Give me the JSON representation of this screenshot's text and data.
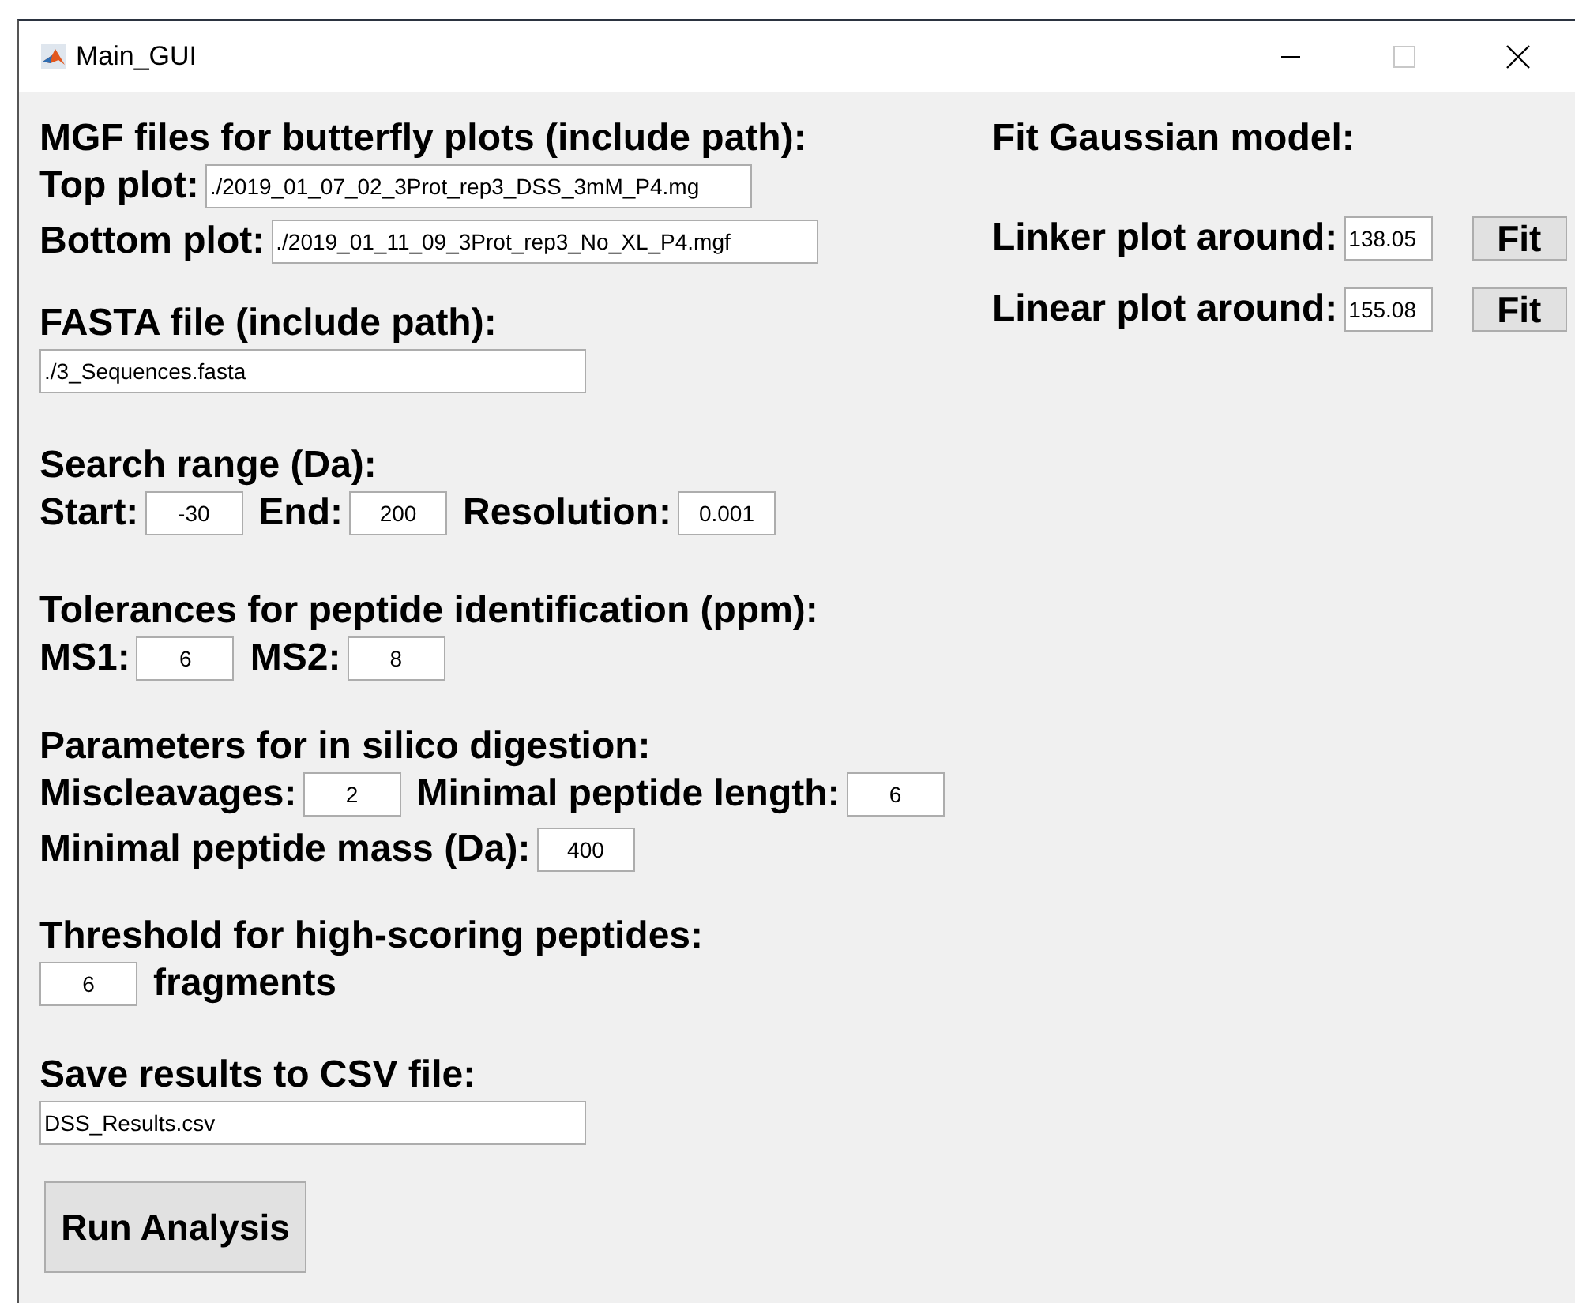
{
  "window": {
    "title": "Main_GUI",
    "maximize_enabled": false
  },
  "left_groups": [
    {
      "heading": "MGF files for butterfly plots (include path):",
      "lines": [
        {
          "items": [
            {
              "kind": "label",
              "text": "Top plot:"
            },
            {
              "kind": "path_field",
              "value": "./2019_01_07_02_3Prot_rep3_DSS_3mM_P4.mg"
            }
          ]
        },
        {
          "items": [
            {
              "kind": "label",
              "text": "Bottom plot:"
            },
            {
              "kind": "path_field",
              "value": "./2019_01_11_09_3Prot_rep3_No_XL_P4.mgf"
            }
          ]
        }
      ]
    },
    {
      "heading": "FASTA file (include path):",
      "lines": [
        {
          "items": [
            {
              "kind": "path_field",
              "value": "./3_Sequences.fasta"
            }
          ]
        }
      ]
    },
    {
      "heading": "Search range (Da):",
      "lines": [
        {
          "items": [
            {
              "kind": "label",
              "text": "Start:"
            },
            {
              "kind": "number_field",
              "value": "-30"
            },
            {
              "kind": "label",
              "text": "End:"
            },
            {
              "kind": "number_field",
              "value": "200"
            },
            {
              "kind": "label",
              "text": "Resolution:"
            },
            {
              "kind": "number_field",
              "value": "0.001"
            }
          ]
        }
      ]
    },
    {
      "heading": "Tolerances for peptide identification (ppm):",
      "lines": [
        {
          "items": [
            {
              "kind": "label",
              "text": "MS1:"
            },
            {
              "kind": "number_field",
              "value": "6"
            },
            {
              "kind": "label",
              "text": "MS2:"
            },
            {
              "kind": "number_field",
              "value": "8"
            }
          ]
        }
      ]
    },
    {
      "heading": "Parameters for in silico digestion:",
      "lines": [
        {
          "items": [
            {
              "kind": "label",
              "text": "Miscleavages:"
            },
            {
              "kind": "number_field",
              "value": "2"
            },
            {
              "kind": "label",
              "text": "Minimal peptide length:"
            },
            {
              "kind": "number_field",
              "value": "6"
            }
          ]
        },
        {
          "items": [
            {
              "kind": "label",
              "text": "Minimal peptide mass (Da):"
            },
            {
              "kind": "number_field",
              "value": "400"
            }
          ]
        }
      ]
    },
    {
      "heading": "Threshold for high-scoring peptides:",
      "lines": [
        {
          "items": [
            {
              "kind": "number_field",
              "value": "6"
            },
            {
              "kind": "label",
              "text": "fragments"
            }
          ]
        }
      ]
    },
    {
      "heading": "Save results to CSV file:",
      "lines": [
        {
          "items": [
            {
              "kind": "path_field",
              "value": "DSS_Results.csv"
            }
          ]
        }
      ]
    }
  ],
  "run_button": "Run Analysis",
  "fit_panel": {
    "heading": "Fit Gaussian model:",
    "rows": [
      {
        "label": "Linker plot around:",
        "value": "138.05",
        "button": "Fit"
      },
      {
        "label": "Linear plot around:",
        "value": "155.08",
        "button": "Fit"
      }
    ]
  }
}
